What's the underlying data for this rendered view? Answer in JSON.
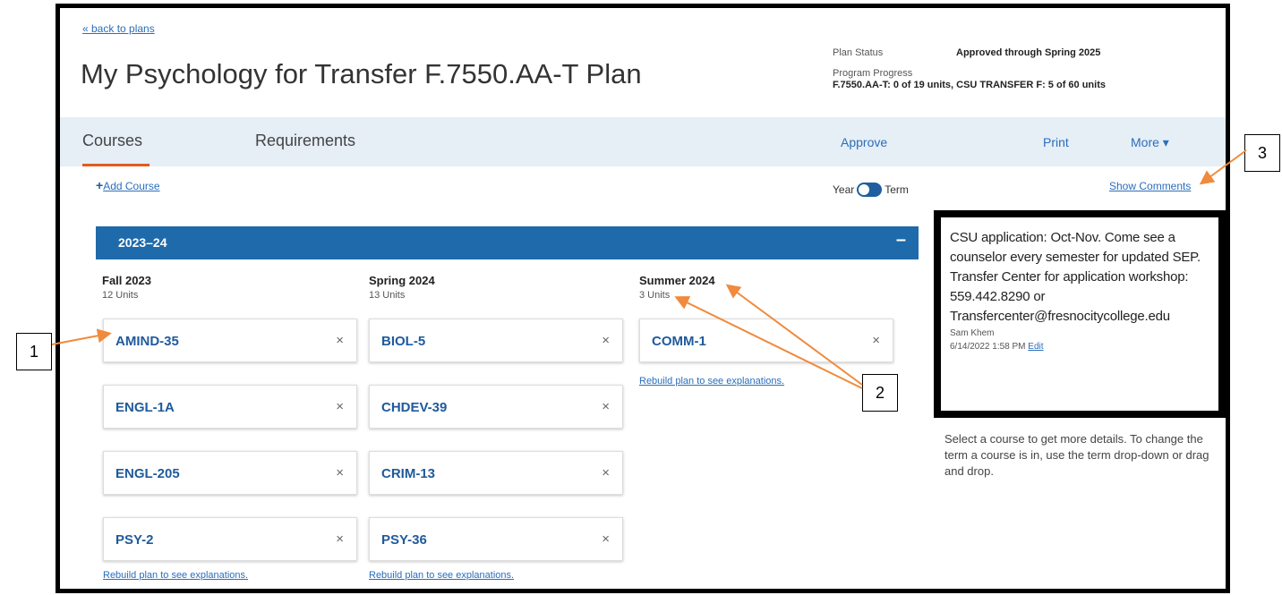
{
  "nav": {
    "back_link": "« back to plans"
  },
  "page_title": "My Psychology for Transfer F.7550.AA-T Plan",
  "status": {
    "plan_status_label": "Plan Status",
    "plan_status_value": "Approved through Spring 2025",
    "progress_label": "Program Progress",
    "progress_value": "F.7550.AA-T: 0 of 19 units, CSU TRANSFER F: 5 of 60 units"
  },
  "tabs": {
    "courses": "Courses",
    "requirements": "Requirements",
    "approve": "Approve",
    "print": "Print",
    "more": "More ▾"
  },
  "toolbar": {
    "add_course": "Add Course",
    "year": "Year",
    "term": "Term",
    "show_comments": "Show Comments"
  },
  "year": {
    "label": "2023–24",
    "collapse": "–"
  },
  "terms": [
    {
      "name": "Fall 2023",
      "units": "12 Units",
      "courses": [
        "AMIND-35",
        "ENGL-1A",
        "ENGL-205",
        "PSY-2"
      ],
      "rebuild": "Rebuild plan to see explanations."
    },
    {
      "name": "Spring 2024",
      "units": "13 Units",
      "courses": [
        "BIOL-5",
        "CHDEV-39",
        "CRIM-13",
        "PSY-36"
      ],
      "rebuild": "Rebuild plan to see explanations."
    },
    {
      "name": "Summer 2024",
      "units": "3 Units",
      "courses": [
        "COMM-1"
      ],
      "rebuild": "Rebuild plan to see explanations."
    }
  ],
  "remove_glyph": "×",
  "comment": {
    "text": "CSU application: Oct-Nov. Come see a counselor every semester for updated SEP. Transfer Center for application workshop: 559.442.8290 or Transfercenter@fresnocitycollege.edu",
    "author": "Sam Khem",
    "date": "6/14/2022 1:58 PM",
    "edit": "Edit"
  },
  "help_text": "Select a course to get more details. To change the term a course is in, use the term drop-down or drag and drop.",
  "callouts": [
    "1",
    "2",
    "3"
  ],
  "colors": {
    "accent": "#1f6aaa",
    "tab_underline": "#e35c1c",
    "arrow": "#f08a3c",
    "link": "#2a6ebb"
  }
}
